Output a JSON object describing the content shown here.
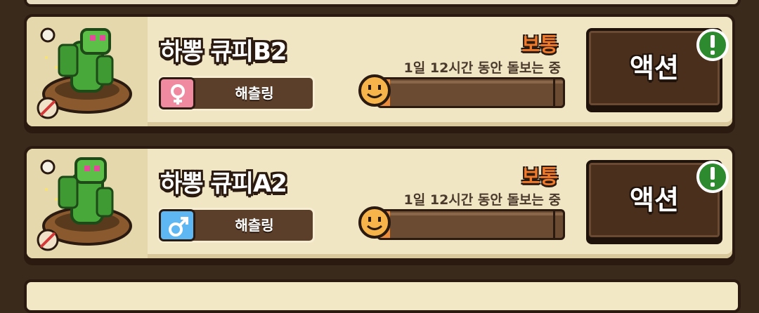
{
  "pets": [
    {
      "name": "하뽕 큐피B2",
      "gender": "female",
      "gender_icon": "female-symbol-icon",
      "stage": "해츨링",
      "status": "보통",
      "care_time": "1일 12시간 동안 돌보는 중",
      "progress_fraction": 0.06,
      "mood_icon": "smiley-face-icon",
      "action_label": "액션",
      "alert_icon": "exclamation-icon"
    },
    {
      "name": "하뽕 큐피A2",
      "gender": "male",
      "gender_icon": "male-symbol-icon",
      "stage": "해츨링",
      "status": "보통",
      "care_time": "1일 12시간 동안 돌보는 중",
      "progress_fraction": 0.06,
      "mood_icon": "smiley-face-icon",
      "action_label": "액션",
      "alert_icon": "exclamation-icon"
    }
  ],
  "colors": {
    "status_normal": "#f07a2a",
    "female": "#f08aa0",
    "male": "#5eb6f2",
    "progress": "#ec8b3a",
    "alert": "#2e8a2e"
  }
}
